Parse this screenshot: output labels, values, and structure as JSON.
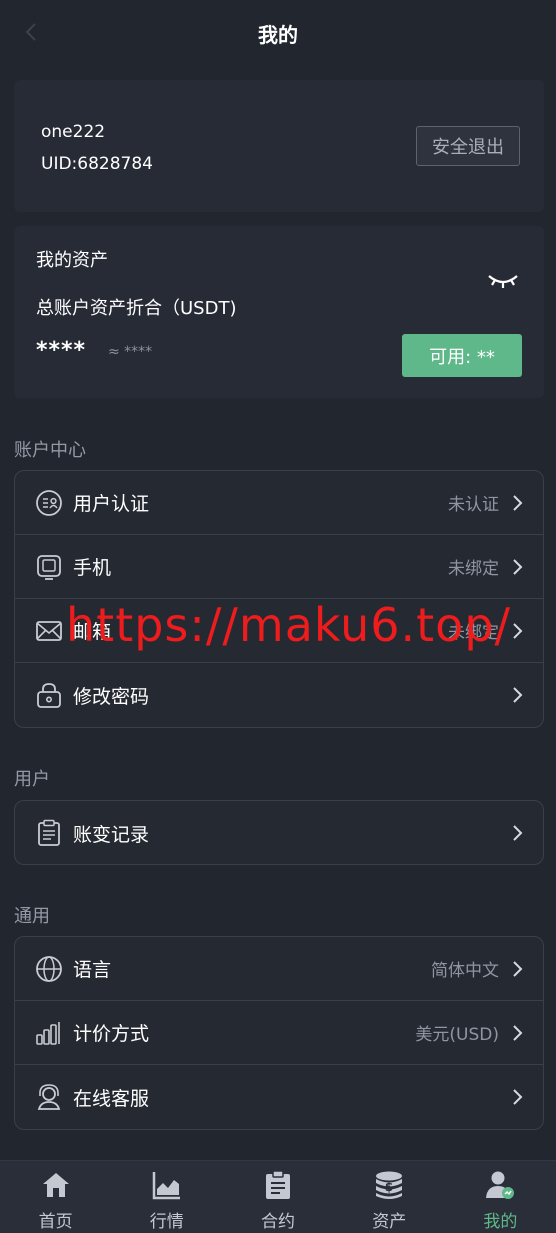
{
  "header": {
    "title": "我的",
    "back_icon": "chevron-left-icon"
  },
  "user": {
    "name": "one222",
    "uid": "UID:6828784",
    "logout_label": "安全退出"
  },
  "assets": {
    "title": "我的资产",
    "subtitle": "总账户资产折合（USDT)",
    "value": "****",
    "approx": "≈ ****",
    "available_label": "可用: **",
    "visibility_icon": "eye-closed-icon"
  },
  "account_section": {
    "label": "账户中心",
    "items": [
      {
        "label": "用户认证",
        "value": "未认证",
        "icon": "id-verify-icon"
      },
      {
        "label": "手机",
        "value": "未绑定",
        "icon": "phone-icon"
      },
      {
        "label": "邮箱",
        "value": "未绑定",
        "icon": "mail-icon"
      },
      {
        "label": "修改密码",
        "value": "",
        "icon": "lock-icon"
      }
    ]
  },
  "user_section": {
    "label": "用户",
    "items": [
      {
        "label": "账变记录",
        "value": "",
        "icon": "clipboard-icon"
      }
    ]
  },
  "general_section": {
    "label": "通用",
    "items": [
      {
        "label": "语言",
        "value": "简体中文",
        "icon": "globe-icon"
      },
      {
        "label": "计价方式",
        "value": "美元(USD)",
        "icon": "bar-chart-icon"
      },
      {
        "label": "在线客服",
        "value": "",
        "icon": "support-icon"
      }
    ]
  },
  "watermark": "https://maku6.top/",
  "tabbar": {
    "items": [
      {
        "label": "首页",
        "icon": "home-icon"
      },
      {
        "label": "行情",
        "icon": "market-chart-icon"
      },
      {
        "label": "合约",
        "icon": "contract-icon"
      },
      {
        "label": "资产",
        "icon": "coins-icon"
      },
      {
        "label": "我的",
        "icon": "profile-icon"
      }
    ],
    "active_index": 4
  },
  "colors": {
    "background": "#22262f",
    "accent": "#5fb88a",
    "watermark": "#ee1c1c"
  }
}
